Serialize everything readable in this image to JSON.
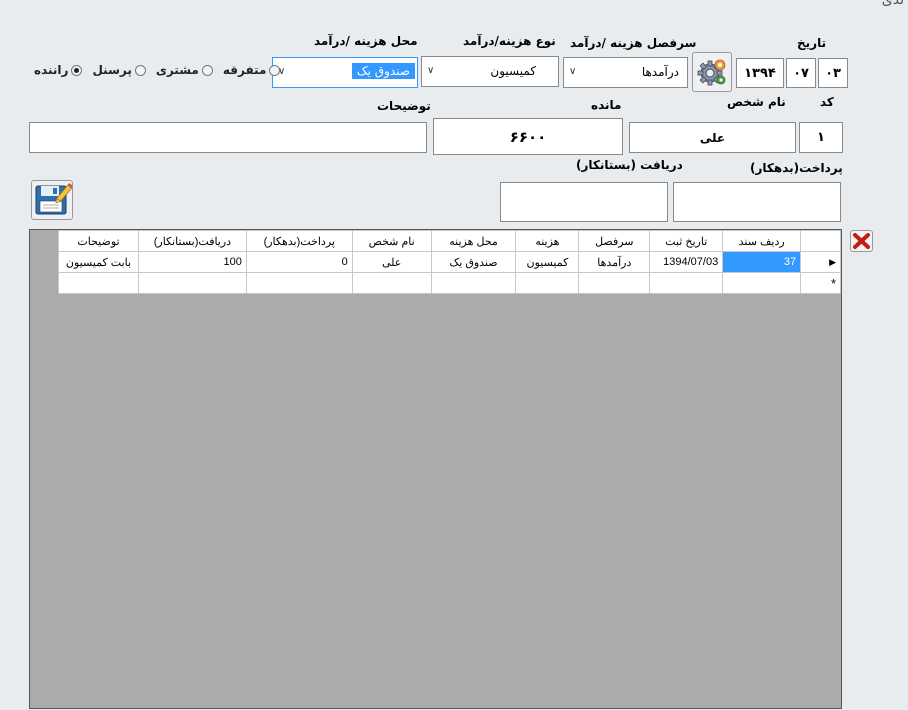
{
  "window": {
    "title_fragment": "ندی"
  },
  "date": {
    "label": "تاریخ",
    "day": "۰۳",
    "month": "۰۷",
    "year": "۱۳۹۴"
  },
  "header_combo": {
    "label": "سرفصل هزینه /درآمد",
    "value": "درآمدها"
  },
  "type_combo": {
    "label": "نوع هزینه/درآمد",
    "value": "کمیسیون"
  },
  "location_combo": {
    "label": "محل هزینه /درآمد",
    "value": "صندوق یک"
  },
  "radios": [
    {
      "label": "راننده",
      "checked": true
    },
    {
      "label": "پرسنل",
      "checked": false
    },
    {
      "label": "مشتری",
      "checked": false
    },
    {
      "label": "متفرقه",
      "checked": false
    }
  ],
  "code": {
    "label": "کد",
    "value": "۱"
  },
  "person": {
    "label": "نام شخص",
    "value": "علی"
  },
  "balance": {
    "label": "مانده",
    "value": "۶۶۰۰"
  },
  "description": {
    "label": "توضیحات",
    "value": ""
  },
  "payment": {
    "label": "پرداخت(بدهکار)",
    "value": ""
  },
  "receipt": {
    "label": "دریافت (بستانکار)",
    "value": ""
  },
  "table": {
    "headers": [
      "ردیف سند",
      "تاریخ ثبت",
      "سرفصل",
      "هزینه",
      "محل هزینه",
      "نام شخص",
      "پرداخت(بدهکار)",
      "دریافت(بستانکار)",
      "توضیحات"
    ],
    "rows": [
      [
        "37",
        "1394/07/03",
        "درآمدها",
        "کمیسیون",
        "صندوق یک",
        "علی",
        "0",
        "100",
        "بابت کمیسیون"
      ]
    ],
    "new_row_marker": "*",
    "current_row_marker": "▶"
  }
}
